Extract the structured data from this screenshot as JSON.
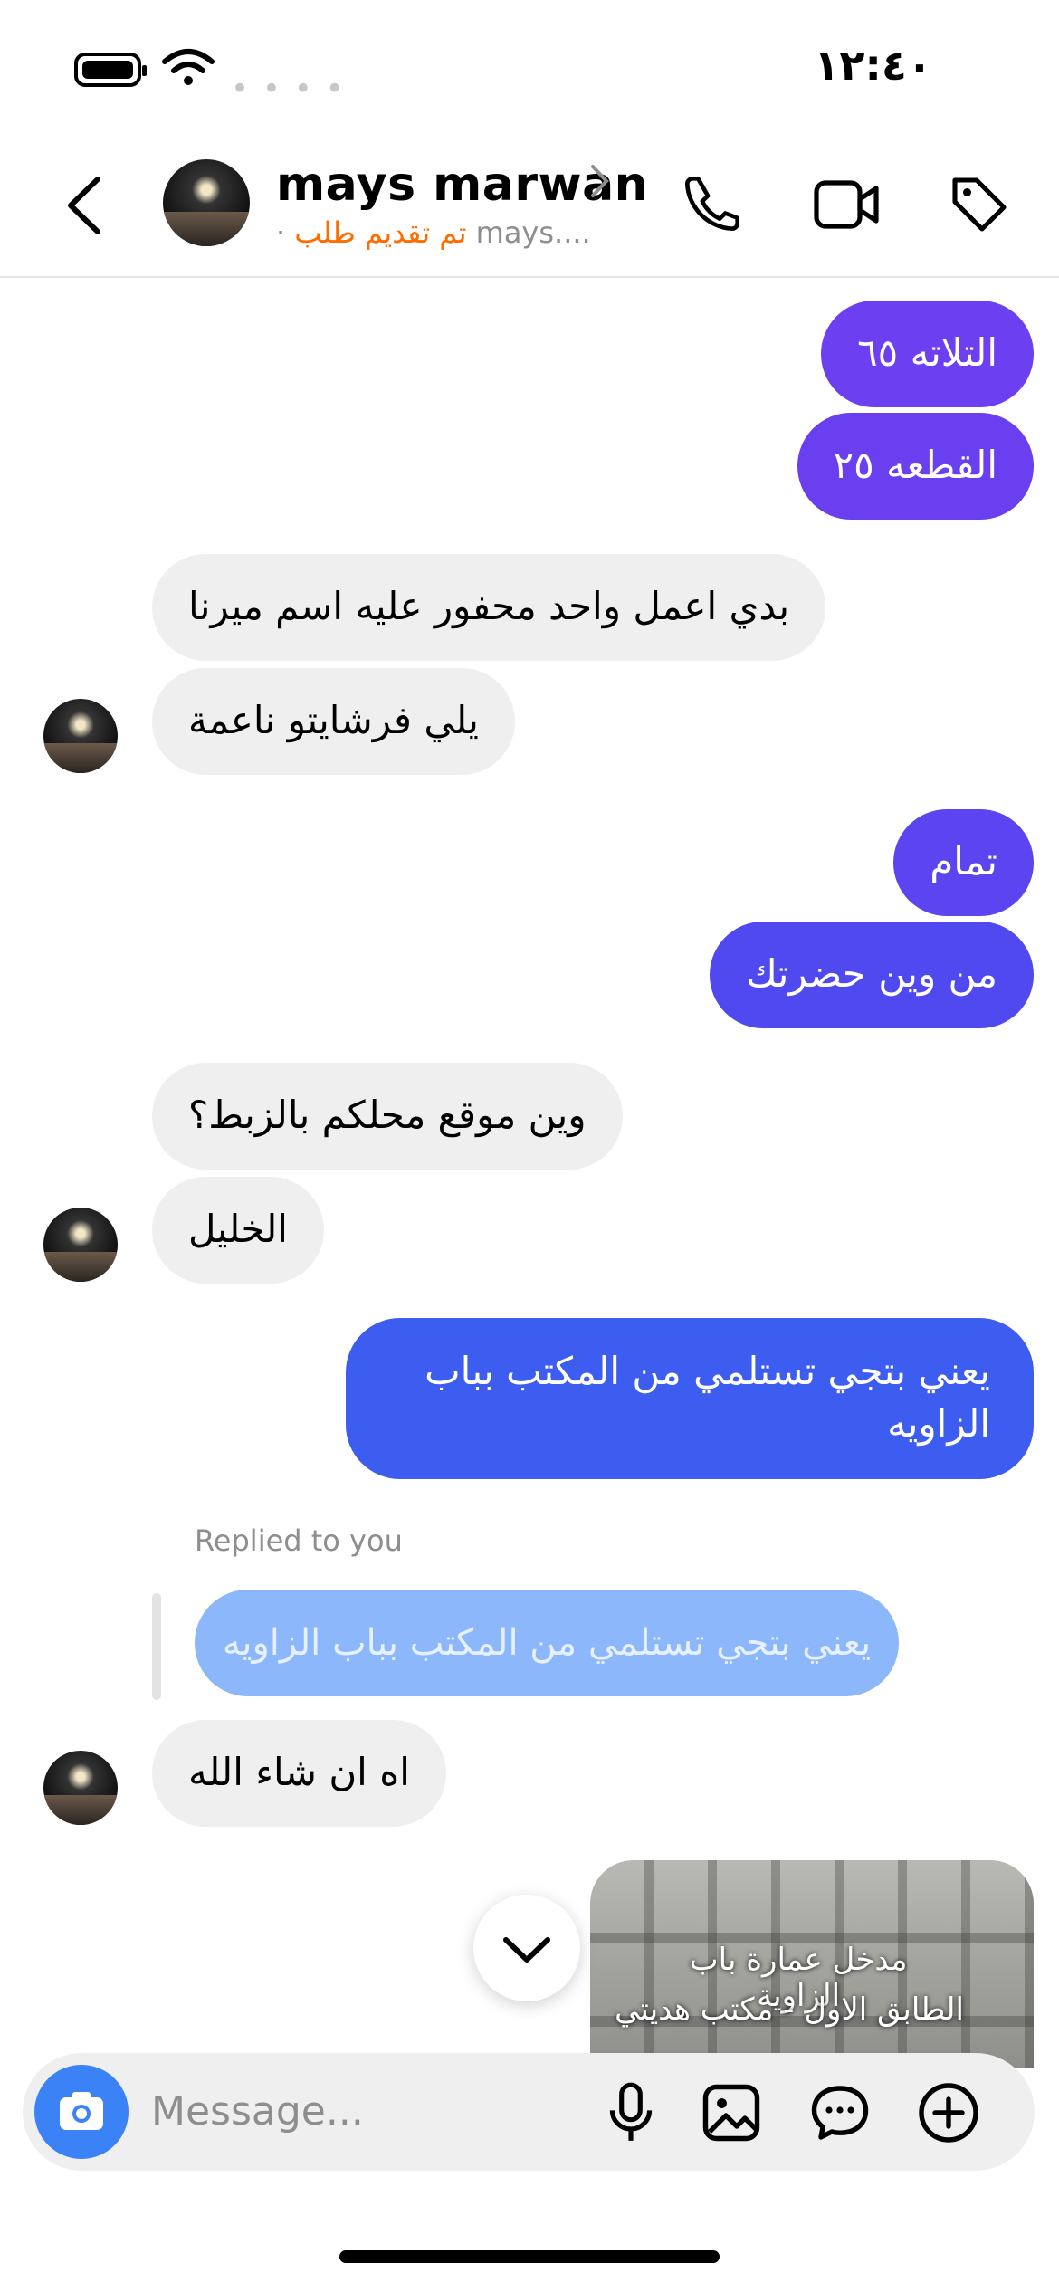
{
  "status_bar": {
    "time": "١٢:٤٠"
  },
  "header": {
    "name": "mays marwan",
    "username": "mays....",
    "separator": "·",
    "status": "تم تقديم طلب"
  },
  "messages": [
    {
      "from": "me",
      "text": "التلاته ٦٥",
      "color": "#6c3ff0"
    },
    {
      "from": "me",
      "text": "القطعه ٢٥",
      "color": "#6a3ff0"
    },
    {
      "from": "them",
      "text": "بدي اعمل واحد   محفور عليه اسم ميرنا"
    },
    {
      "from": "them",
      "text": "يلي فرشايتو ناعمة"
    },
    {
      "from": "me",
      "text": "تمام",
      "color": "#5a45f0"
    },
    {
      "from": "me",
      "text": "من وين حضرتك",
      "color": "#5049f0"
    },
    {
      "from": "them",
      "text": "وين موقع محلكم بالزبط؟"
    },
    {
      "from": "them",
      "text": "الخليل"
    },
    {
      "from": "me",
      "text_line1": "يعني بتجي  تستلمي من المكتب بباب",
      "text_line2": "الزاويه",
      "color": "#3d5cf0"
    },
    {
      "from": "them",
      "replied_label": "Replied to you",
      "reply_quote": "يعني بتجي  تستلمي من المكتب بباب الزاويه",
      "text": "اه ان شاء الله"
    }
  ],
  "photo_message": {
    "caption_line1": "مدخل عمارة باب الزاوية",
    "caption_line2": "الطابق الاول - مكتب هديتي"
  },
  "composer": {
    "placeholder": "Message..."
  },
  "colors": {
    "accent": "#3b82f6",
    "orange": "#ff6d00"
  }
}
